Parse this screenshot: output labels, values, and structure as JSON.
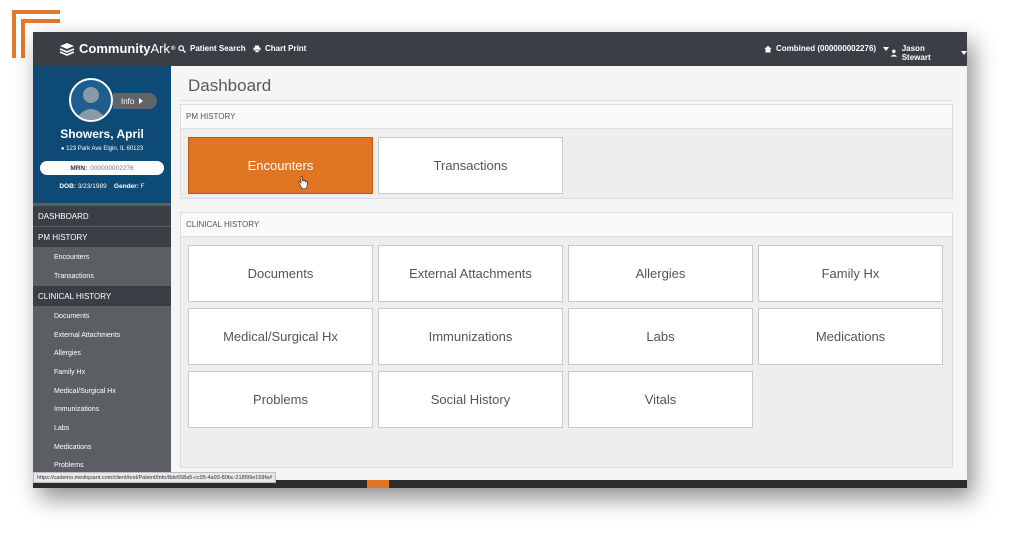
{
  "brand": {
    "accent": "#e07524",
    "topbar_color": "#3b3f45",
    "patient_card_color": "#0d4a75"
  },
  "header": {
    "logo_text": "Community",
    "logo_text_suffix": "Ark",
    "logo_sup": "®",
    "nav": {
      "patient_search": "Patient Search",
      "chart_print": "Chart Print"
    },
    "location": "Combined (000000002276)",
    "user": "Jason Stewart"
  },
  "patient": {
    "info_label": "Info",
    "name": "Showers, April",
    "address": "123 Park Ave Elgin, IL 60123",
    "mrn_label": "MRN:",
    "mrn_value": "000000002276",
    "dob_label": "DOB:",
    "dob_value": "3/23/1989",
    "gender_label": "Gender:",
    "gender_value": "F"
  },
  "sidebar": {
    "dashboard": "DASHBOARD",
    "pm_history": "PM HISTORY",
    "pm_items": [
      "Encounters",
      "Transactions"
    ],
    "clinical_history": "CLINICAL HISTORY",
    "clinical_items": [
      "Documents",
      "External Attachments",
      "Allergies",
      "Family Hx",
      "Medical/Surgical Hx",
      "Immunizations",
      "Labs",
      "Medications",
      "Problems"
    ]
  },
  "main": {
    "title": "Dashboard",
    "pm_section": {
      "label": "PM HISTORY",
      "tiles": [
        "Encounters",
        "Transactions"
      ],
      "active_tile": "Encounters"
    },
    "clinical_section": {
      "label": "CLINICAL HISTORY",
      "tiles": [
        "Documents",
        "External Attachments",
        "Allergies",
        "Family Hx",
        "Medical/Surgical Hx",
        "Immunizations",
        "Labs",
        "Medications",
        "Problems",
        "Social History",
        "Vitals"
      ]
    }
  },
  "status_bar": {
    "url": "https://cademo.mediquant.com/client/test/Patient/Info/8de558a5-cc05-4a93-80bc-218f99e159fa#"
  }
}
